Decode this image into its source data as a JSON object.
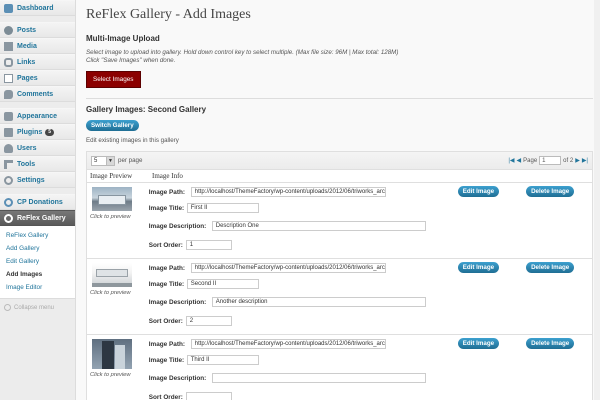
{
  "sidebar": {
    "items": [
      {
        "label": "Dashboard",
        "icon": "dashboard-icon",
        "color": "#5b8fb5"
      },
      {
        "label": "Posts",
        "icon": "pin-icon",
        "color": "#7d8c96"
      },
      {
        "label": "Media",
        "icon": "media-icon",
        "color": "#8a96a0"
      },
      {
        "label": "Links",
        "icon": "link-icon",
        "color": "#8a96a0"
      },
      {
        "label": "Pages",
        "icon": "pages-icon",
        "color": "#8a96a0"
      },
      {
        "label": "Comments",
        "icon": "comments-icon",
        "color": "#8a96a0"
      },
      {
        "label": "Appearance",
        "icon": "appearance-icon",
        "color": "#8a96a0"
      },
      {
        "label": "Plugins",
        "icon": "plugin-icon",
        "color": "#8a96a0",
        "badge": "5"
      },
      {
        "label": "Users",
        "icon": "users-icon",
        "color": "#8a96a0"
      },
      {
        "label": "Tools",
        "icon": "tools-icon",
        "color": "#8a96a0"
      },
      {
        "label": "Settings",
        "icon": "settings-icon",
        "color": "#8a96a0"
      },
      {
        "label": "CP Donations",
        "icon": "gear-icon",
        "color": "#5b8fb5"
      },
      {
        "label": "ReFlex Gallery",
        "icon": "gear-icon",
        "color": "#ffffff"
      }
    ],
    "submenu": [
      "ReFlex Gallery",
      "Add Gallery",
      "Edit Gallery",
      "Add Images",
      "Image Editor"
    ],
    "current_submenu": "Add Images",
    "collapse": "Collapse menu"
  },
  "page": {
    "title": "ReFlex Gallery - Add Images",
    "upload_title": "Multi-Image Upload",
    "help_line1": "Select image to upload into gallery. Hold down control key to select multiple. (Max file size: 96M | Max total: 128M)",
    "help_line2": "Click \"Save Images\" when done.",
    "select_button": "Select Images",
    "gallery_title": "Gallery Images: Second Gallery",
    "switch_button": "Switch Gallery",
    "edit_existing": "Edit existing images in this gallery"
  },
  "table": {
    "per_page_value": "5",
    "per_page_label": "per page",
    "page_label": "Page",
    "page_value": "1",
    "of_label": "of 2",
    "col_preview": "Image Preview",
    "col_info": "Image Info",
    "caption": "Click to preview",
    "labels": {
      "path": "Image Path:",
      "title": "Image Title:",
      "desc": "Image Description:",
      "order": "Sort Order:"
    },
    "edit_button": "Edit Image",
    "delete_button": "Delete Image",
    "rows": [
      {
        "path": "http://localhost/ThemeFactory/wp-content/uploads/2012/06/triworks_arch8",
        "title": "First II",
        "desc": "Description One",
        "order": "1"
      },
      {
        "path": "http://localhost/ThemeFactory/wp-content/uploads/2012/06/triworks_arch9",
        "title": "Second II",
        "desc": "Another description",
        "order": "2"
      },
      {
        "path": "http://localhost/ThemeFactory/wp-content/uploads/2012/06/triworks_arch4",
        "title": "Third II",
        "desc": "",
        "order": ""
      }
    ]
  }
}
